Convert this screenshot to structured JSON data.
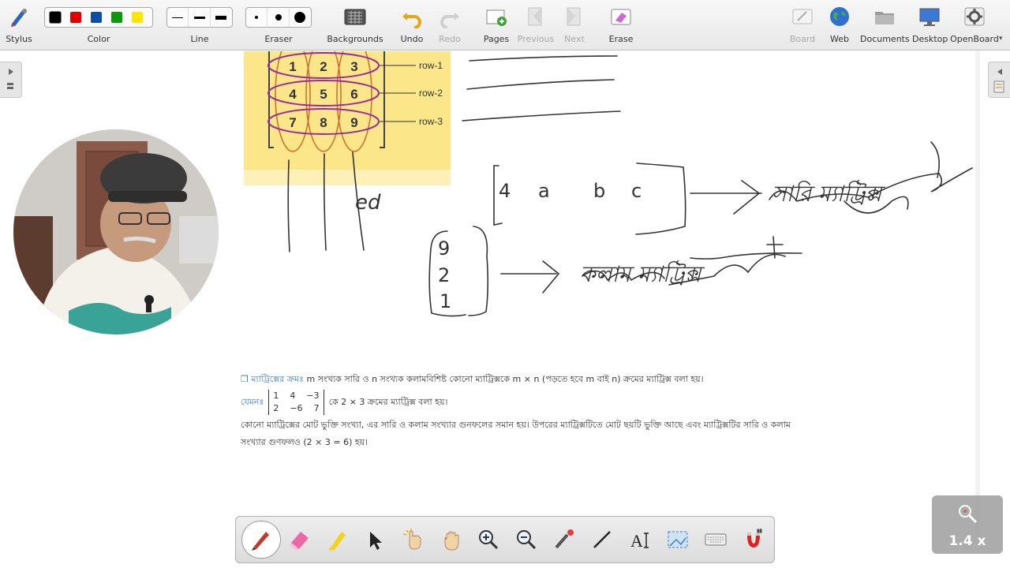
{
  "toolbar": {
    "stylus": "Stylus",
    "color": "Color",
    "line": "Line",
    "eraser": "Eraser",
    "backgrounds": "Backgrounds",
    "undo": "Undo",
    "redo": "Redo",
    "pages": "Pages",
    "previous": "Previous",
    "next": "Next",
    "erase": "Erase",
    "board": "Board",
    "web": "Web",
    "documents": "Documents",
    "desktop": "Desktop",
    "openboard": "OpenBoard",
    "colors": [
      "#000000",
      "#e00000",
      "#0b4ea2",
      "#0a9a0a",
      "#ffe600"
    ]
  },
  "board": {
    "matrix_numbers": [
      "1",
      "2",
      "3",
      "4",
      "5",
      "6",
      "7",
      "8",
      "9"
    ],
    "row_labels": [
      "row-1",
      "row-2",
      "row-3"
    ],
    "hand_ed": "ed",
    "row_matrix_entries": [
      "4",
      "a",
      "b",
      "c"
    ],
    "row_matrix_caption": "সারি ম্যাট্রিক্স",
    "col_matrix_entries": [
      "9",
      "2",
      "1"
    ],
    "col_matrix_caption": "কলাম ম্যাট্রিক্স"
  },
  "textbook": {
    "heading": "ম্যাট্রিক্সের ক্রমঃ",
    "line1": "m সংখ্যক সারি ও n সংখ্যক কলামবিশিষ্ট কোনো ম্যাট্রিক্সকে m × n (পড়তে হবে m বাই n) ক্রমের ম্যাট্রিক্স বলা হয়।",
    "example_label": "যেমনঃ",
    "example_row1": [
      "1",
      "4",
      "−3"
    ],
    "example_row2": [
      "2",
      "−6",
      "7"
    ],
    "example_text": "কে 2 × 3 ক্রমের ম্যাট্রিক্স বলা হয়।",
    "para1": "কোনো ম্যাট্রিক্সের মোট ভুক্তি সংখ্যা, এর সারি ও কলাম সংখ্যার গুনফলের সমান হয়। উপরের ম্যাট্রিক্সটিতে মোট ছয়টি ভুক্তি আছে এবং ম্যাট্রিক্সটির সারি ও কলাম",
    "para2": "সংখ্যার গুণফলও (2 × 3 = 6) হয়।"
  },
  "zoom": {
    "level": "1.4 x"
  }
}
